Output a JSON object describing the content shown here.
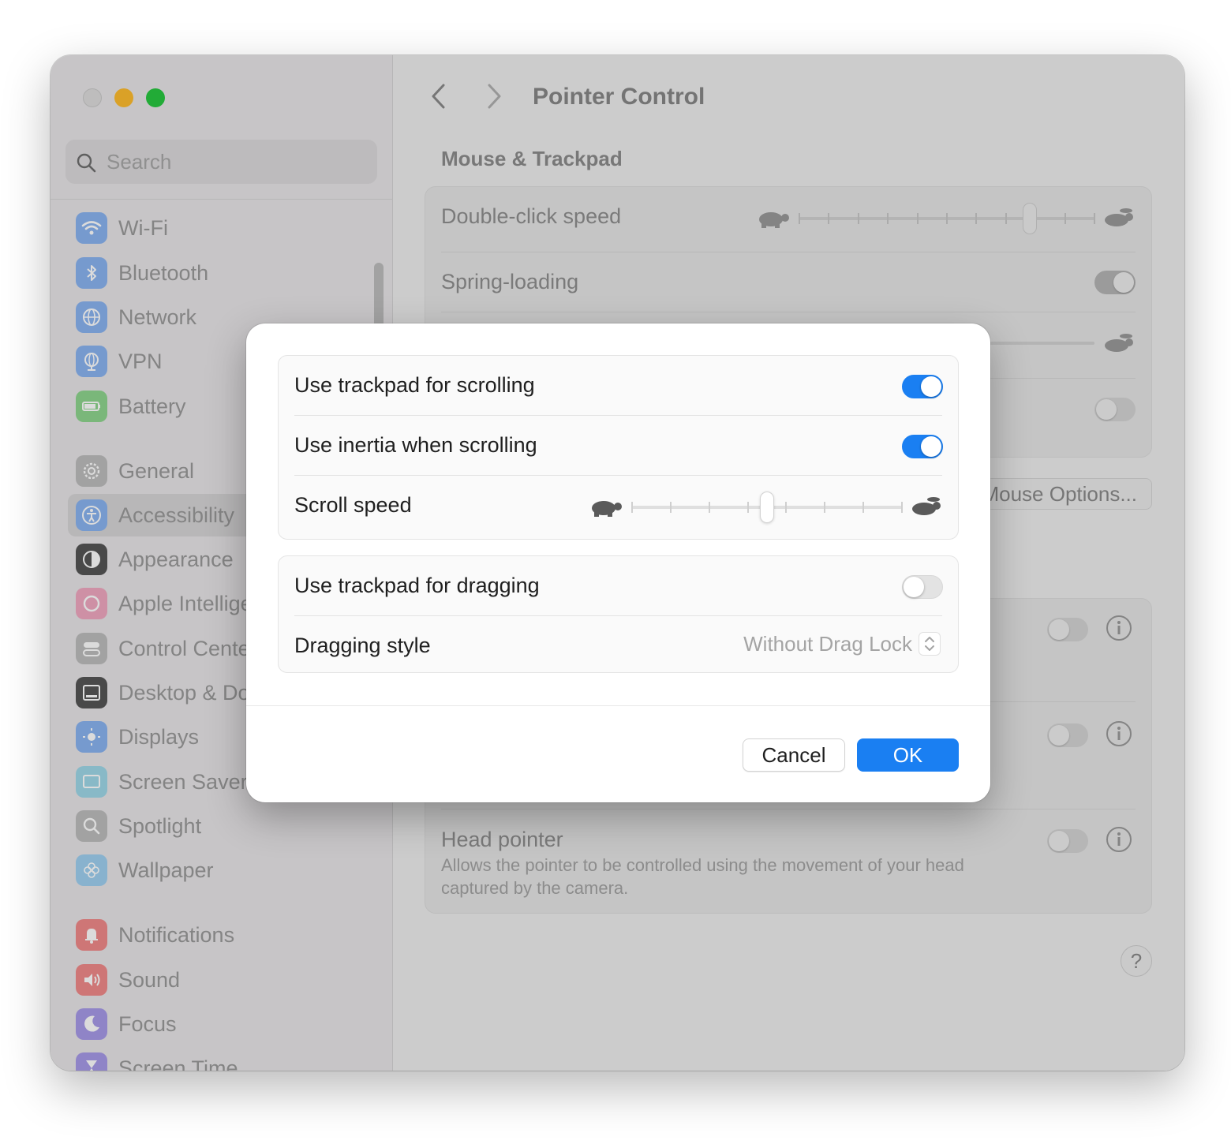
{
  "sidebar": {
    "search_placeholder": "Search",
    "items": [
      {
        "label": "Wi-Fi",
        "icon": "wifi-icon",
        "color": "#8ab4f0"
      },
      {
        "label": "Bluetooth",
        "icon": "bluetooth-icon",
        "color": "#8ab4f0"
      },
      {
        "label": "Network",
        "icon": "globe-icon",
        "color": "#8ab4f0"
      },
      {
        "label": "VPN",
        "icon": "vpn-globe-icon",
        "color": "#8ab4f0"
      },
      {
        "label": "Battery",
        "icon": "battery-icon",
        "color": "#8fd68e"
      },
      {
        "label": "General",
        "icon": "gear-icon",
        "color": "#bdbdbd"
      },
      {
        "label": "Accessibility",
        "icon": "accessibility-icon",
        "color": "#8ab4f0"
      },
      {
        "label": "Appearance",
        "icon": "appearance-icon",
        "color": "#555555"
      },
      {
        "label": "Apple Intellige",
        "icon": "apple-intelligence-icon",
        "color": "#f0a8c0"
      },
      {
        "label": "Control Cente",
        "icon": "control-center-icon",
        "color": "#bdbdbd"
      },
      {
        "label": "Desktop & Do",
        "icon": "desktop-dock-icon",
        "color": "#555555"
      },
      {
        "label": "Displays",
        "icon": "displays-icon",
        "color": "#8ab4f0"
      },
      {
        "label": "Screen Saver",
        "icon": "screen-saver-icon",
        "color": "#9fd8e8"
      },
      {
        "label": "Spotlight",
        "icon": "spotlight-icon",
        "color": "#bdbdbd"
      },
      {
        "label": "Wallpaper",
        "icon": "wallpaper-icon",
        "color": "#9fd0f0"
      },
      {
        "label": "Notifications",
        "icon": "notifications-icon",
        "color": "#f08a8a"
      },
      {
        "label": "Sound",
        "icon": "sound-icon",
        "color": "#f08a8a"
      },
      {
        "label": "Focus",
        "icon": "focus-moon-icon",
        "color": "#a79ae8"
      },
      {
        "label": "Screen Time",
        "icon": "screen-time-icon",
        "color": "#a79ae8"
      }
    ]
  },
  "main": {
    "title": "Pointer Control",
    "section_title": "Mouse & Trackpad",
    "double_click_label": "Double-click speed",
    "double_click_level": 0.78,
    "spring_loading_label": "Spring-loading",
    "spring_loading_on": true,
    "mouse_options_label": "Mouse Options...",
    "head_pointer_label": "Head pointer",
    "head_pointer_desc_1": "Allows the pointer to be controlled using the movement of your head",
    "head_pointer_desc_2": "captured by the camera.",
    "help_label": "?"
  },
  "sheet": {
    "use_trackpad_scrolling_label": "Use trackpad for scrolling",
    "use_trackpad_scrolling_on": true,
    "use_inertia_label": "Use inertia when scrolling",
    "use_inertia_on": true,
    "scroll_speed_label": "Scroll speed",
    "scroll_speed_level": 0.5,
    "use_trackpad_dragging_label": "Use trackpad for dragging",
    "use_trackpad_dragging_on": false,
    "dragging_style_label": "Dragging style",
    "dragging_style_value": "Without Drag Lock",
    "cancel_label": "Cancel",
    "ok_label": "OK"
  },
  "colors": {
    "accent": "#1a7ff2",
    "traffic_min": "#febc2e",
    "traffic_max": "#28c840"
  }
}
